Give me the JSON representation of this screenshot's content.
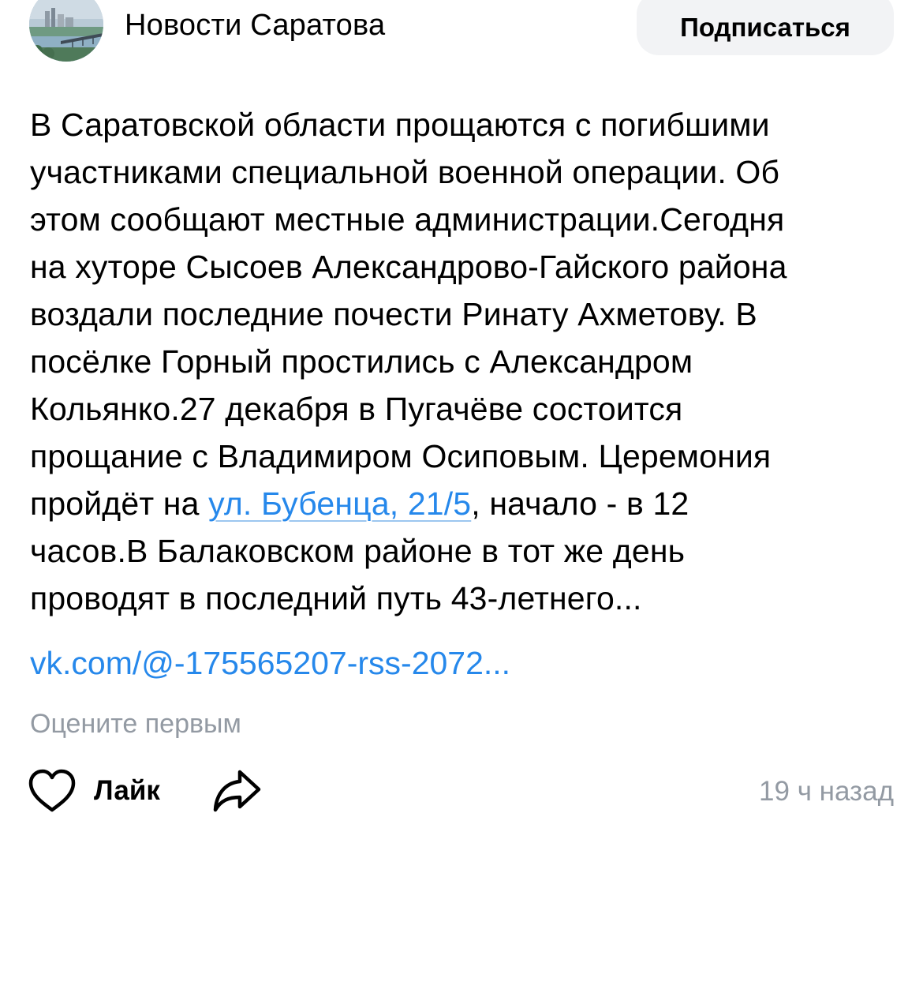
{
  "header": {
    "channel_name": "Новости Саратова",
    "subscribe_label": "Подписаться",
    "avatar_icon": "city-river-bridge-photo"
  },
  "post": {
    "lines": [
      "В Саратовской области прощаются с погибшими",
      "участниками специальной военной операции. Об",
      "этом сообщают местные администрации.Сегодня",
      "на хуторе Сысоев Александрово-Гайского района",
      "воздали последние почести Ринату Ахметову. В",
      "посёлке Горный простились с Александром",
      "Кольянко.27 декабря в Пугачёве состоится",
      "прощание с Владимиром Осиповым. Церемония"
    ],
    "line9_before": "пройдёт на ",
    "address_link": "ул. Бубенца, 21/5",
    "line9_after": ", начало - в 12",
    "line10": "часов.В Балаковском районе в тот же день",
    "line11": "проводят в последний путь 43-летнего..."
  },
  "article_link": "vk.com/@-175565207-rss-2072...",
  "rating": {
    "text": "Оцените первым"
  },
  "actions": {
    "like_label": "Лайк",
    "like_icon": "heart-icon",
    "share_icon": "share-icon",
    "timestamp": "19 ч назад"
  },
  "colors": {
    "link": "#2688eb",
    "muted": "#939aa3",
    "button_bg": "#f2f3f5"
  }
}
